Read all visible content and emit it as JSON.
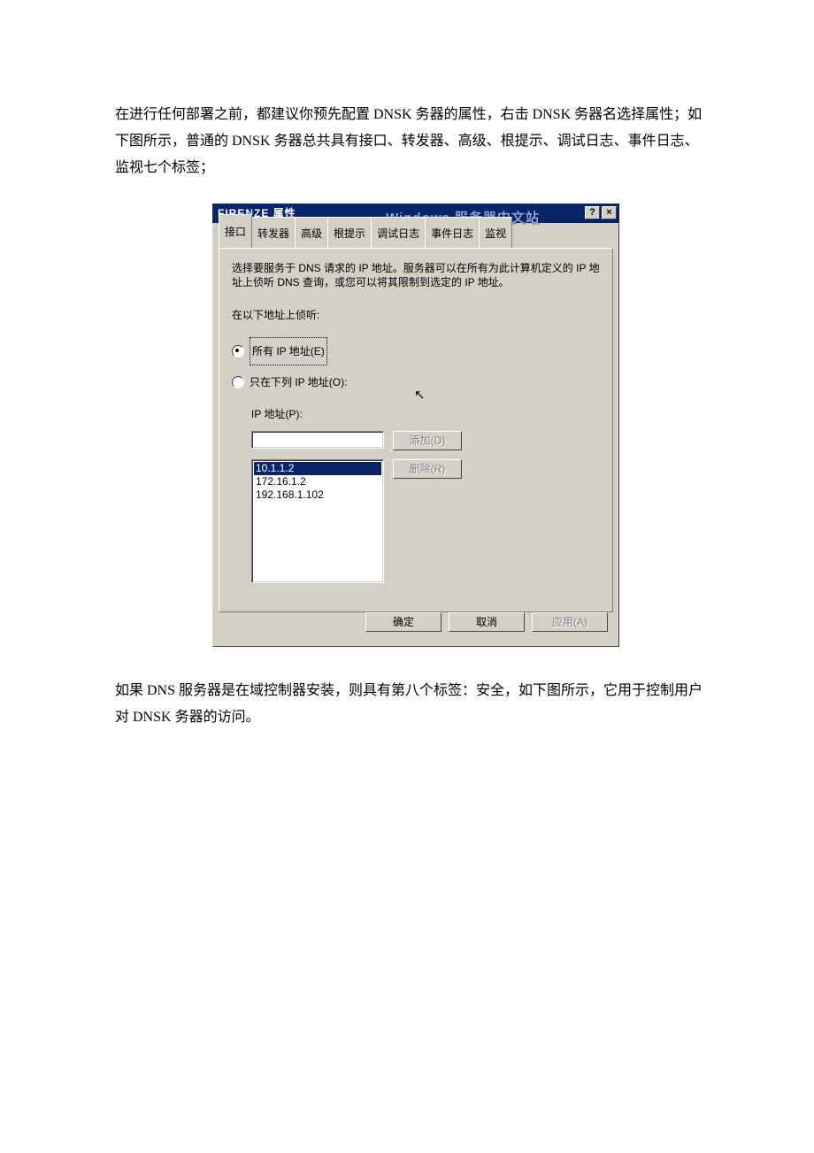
{
  "document": {
    "para1": "在进行任何部署之前，都建议你预先配置 DNSK 务器的属性，右击 DNSK 务器名选择属性；如下图所示，普通的 DNSK 务器总共具有接口、转发器、高级、根提示、调试日志、事件日志、监视七个标签；",
    "para2": "如果 DNS 服务器是在域控制器安装，则具有第八个标签：安全，如下图所示，它用于控制用户对 DNSK 务器的访问。"
  },
  "dialog": {
    "title": "FIRENZE 属性",
    "watermark": "Windows 服务器中文站",
    "help_btn": "?",
    "close_btn": "×",
    "tabs": [
      "接口",
      "转发器",
      "高级",
      "根提示",
      "调试日志",
      "事件日志",
      "监视"
    ],
    "instruction": "选择要服务于 DNS 请求的 IP 地址。服务器可以在所有为此计算机定义的 IP 地址上侦听 DNS 查询，或您可以将其限制到选定的 IP 地址。",
    "listen_label": "在以下地址上侦听:",
    "radio_all": "所有 IP 地址(E)",
    "radio_only": "只在下列 IP 地址(O):",
    "ip_label": "IP 地址(P):",
    "add_btn": "添加(D)",
    "remove_btn": "删除(R)",
    "ip_list": [
      "10.1.1.2",
      "172.16.1.2",
      "192.168.1.102"
    ],
    "ok": "确定",
    "cancel": "取消",
    "apply": "应用(A)"
  }
}
